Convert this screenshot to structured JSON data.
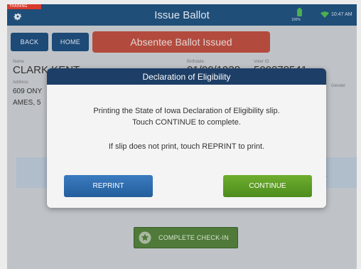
{
  "header": {
    "training_badge": "TRAINING",
    "title": "Issue Ballot",
    "battery": "100%",
    "time": "10:47 AM"
  },
  "toolbar": {
    "back_label": "BACK",
    "home_label": "HOME",
    "status_banner": "Absentee Ballot Issued"
  },
  "voter": {
    "name_label": "Name",
    "name": "CLARK KENT",
    "address_label": "Address",
    "address_line1": "609 ONY",
    "address_line2": "AMES, 5",
    "birthdate_label": "Birthdate",
    "birthdate": "01/00/1938",
    "voter_id_label": "Voter ID",
    "voter_id": "500278541",
    "gender_label": "Gender"
  },
  "background": {
    "panel_text_1": "e",
    "panel_text_2": "v."
  },
  "complete_checkin_label": "COMPLETE CHECK-IN",
  "modal": {
    "title": "Declaration of Eligibility",
    "line1": "Printing the State of Iowa Declaration of Eligibility slip.",
    "line2": "Touch CONTINUE to complete.",
    "line3": "If slip does not print, touch REPRINT to print.",
    "reprint_label": "REPRINT",
    "continue_label": "CONTINUE"
  },
  "colors": {
    "header": "#1f4e79",
    "banner": "#c0483a",
    "reprint": "#2f6fb0",
    "continue": "#5fa52a"
  },
  "icons": [
    "gear-icon",
    "battery-icon",
    "wifi-icon",
    "star-icon"
  ]
}
